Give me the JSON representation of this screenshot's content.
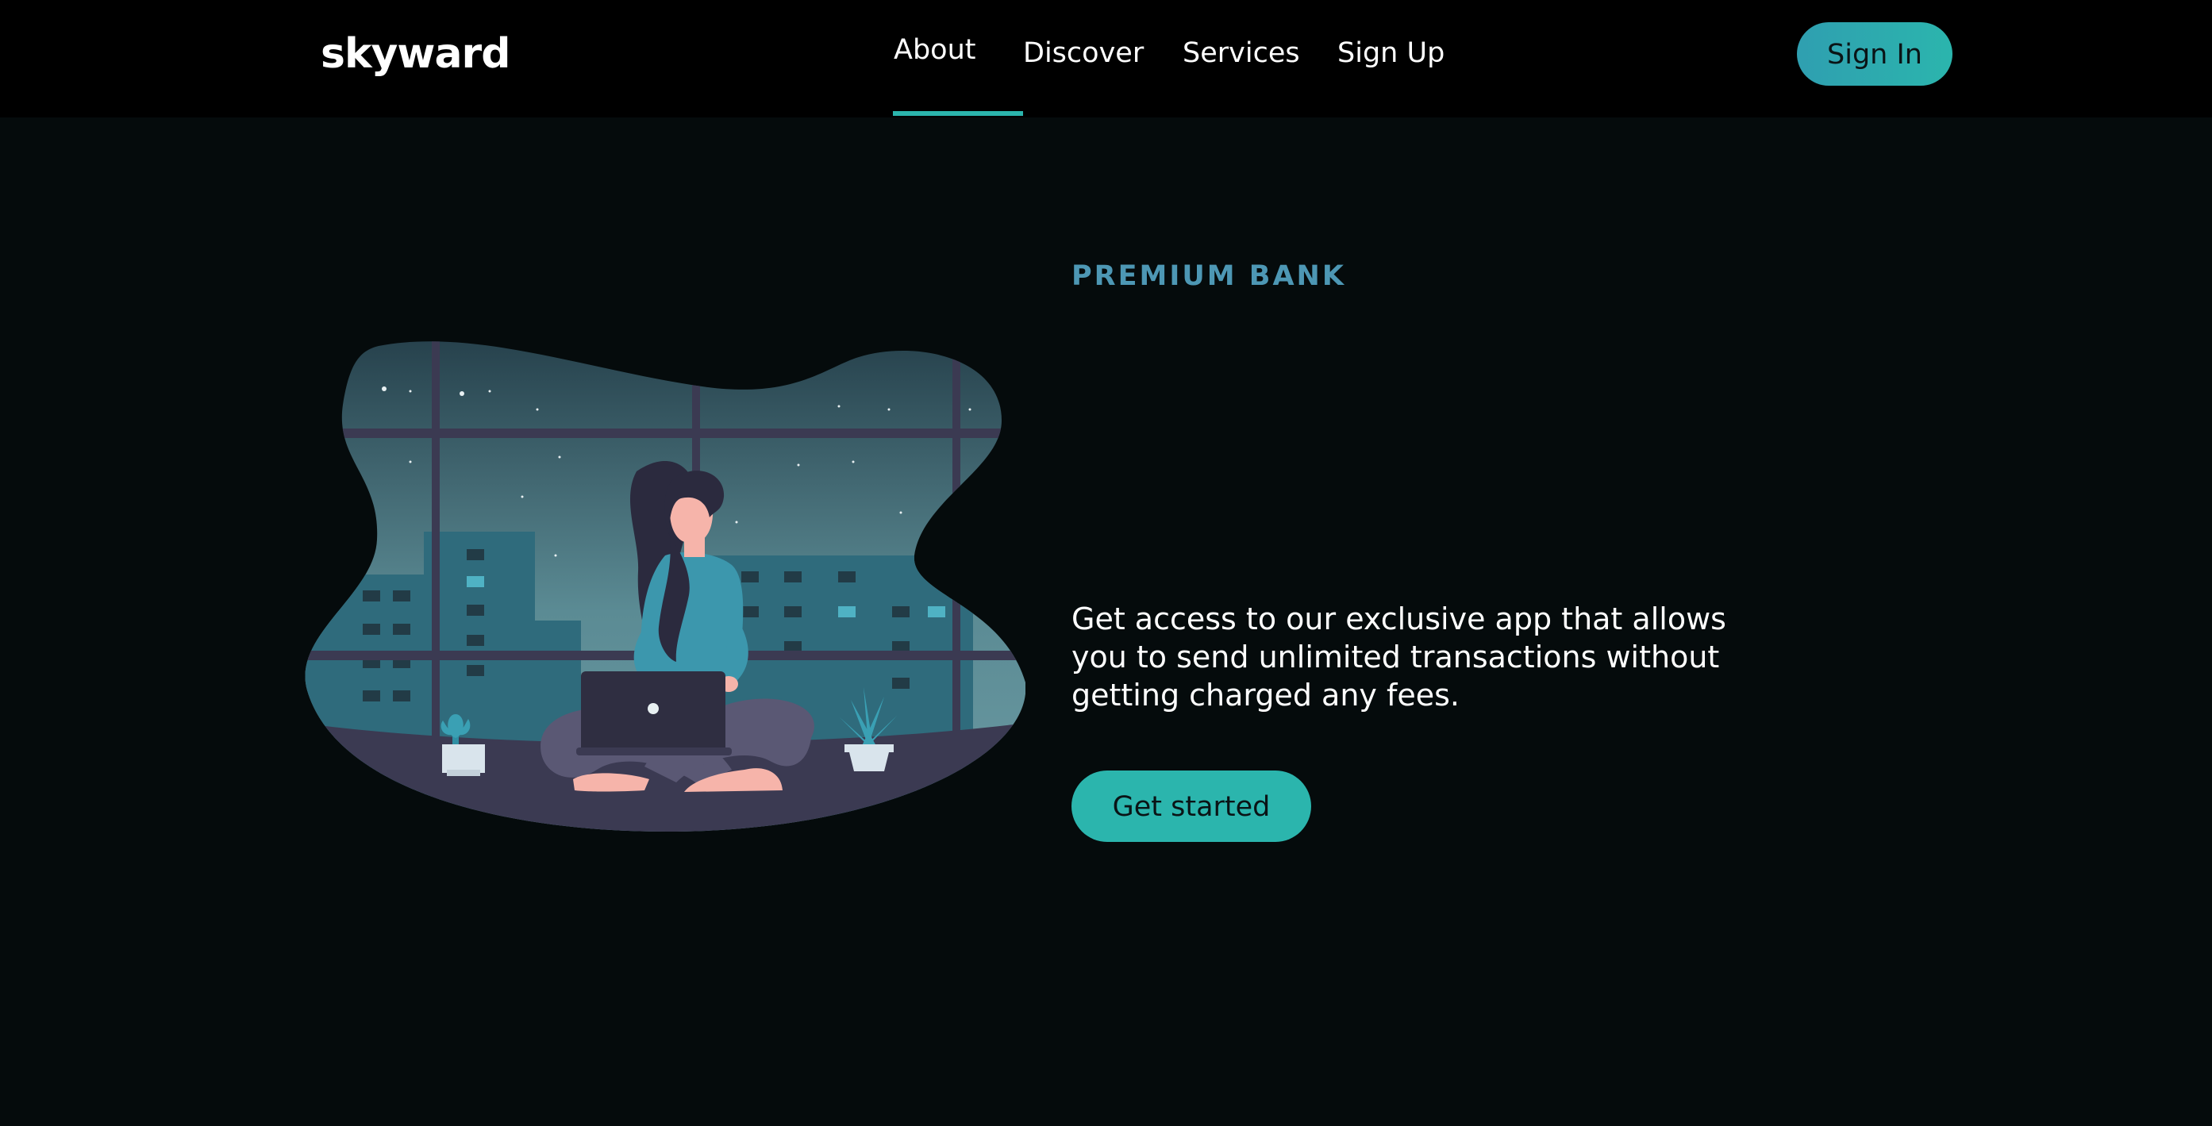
{
  "brand": {
    "name": "skyward"
  },
  "nav": {
    "items": [
      {
        "label": "About",
        "active": true
      },
      {
        "label": "Discover",
        "active": false
      },
      {
        "label": "Services",
        "active": false
      },
      {
        "label": "Sign Up",
        "active": false
      }
    ],
    "signin_label": "Sign In"
  },
  "hero": {
    "eyebrow": "PREMIUM BANK",
    "description": "Get access to our exclusive app that allows you to send unlimited transactions without getting charged any fees.",
    "cta_label": "Get started"
  },
  "colors": {
    "background": "#050b0c",
    "header": "#000000",
    "accent": "#2bb5ad",
    "eyebrow": "#4d97b4"
  }
}
